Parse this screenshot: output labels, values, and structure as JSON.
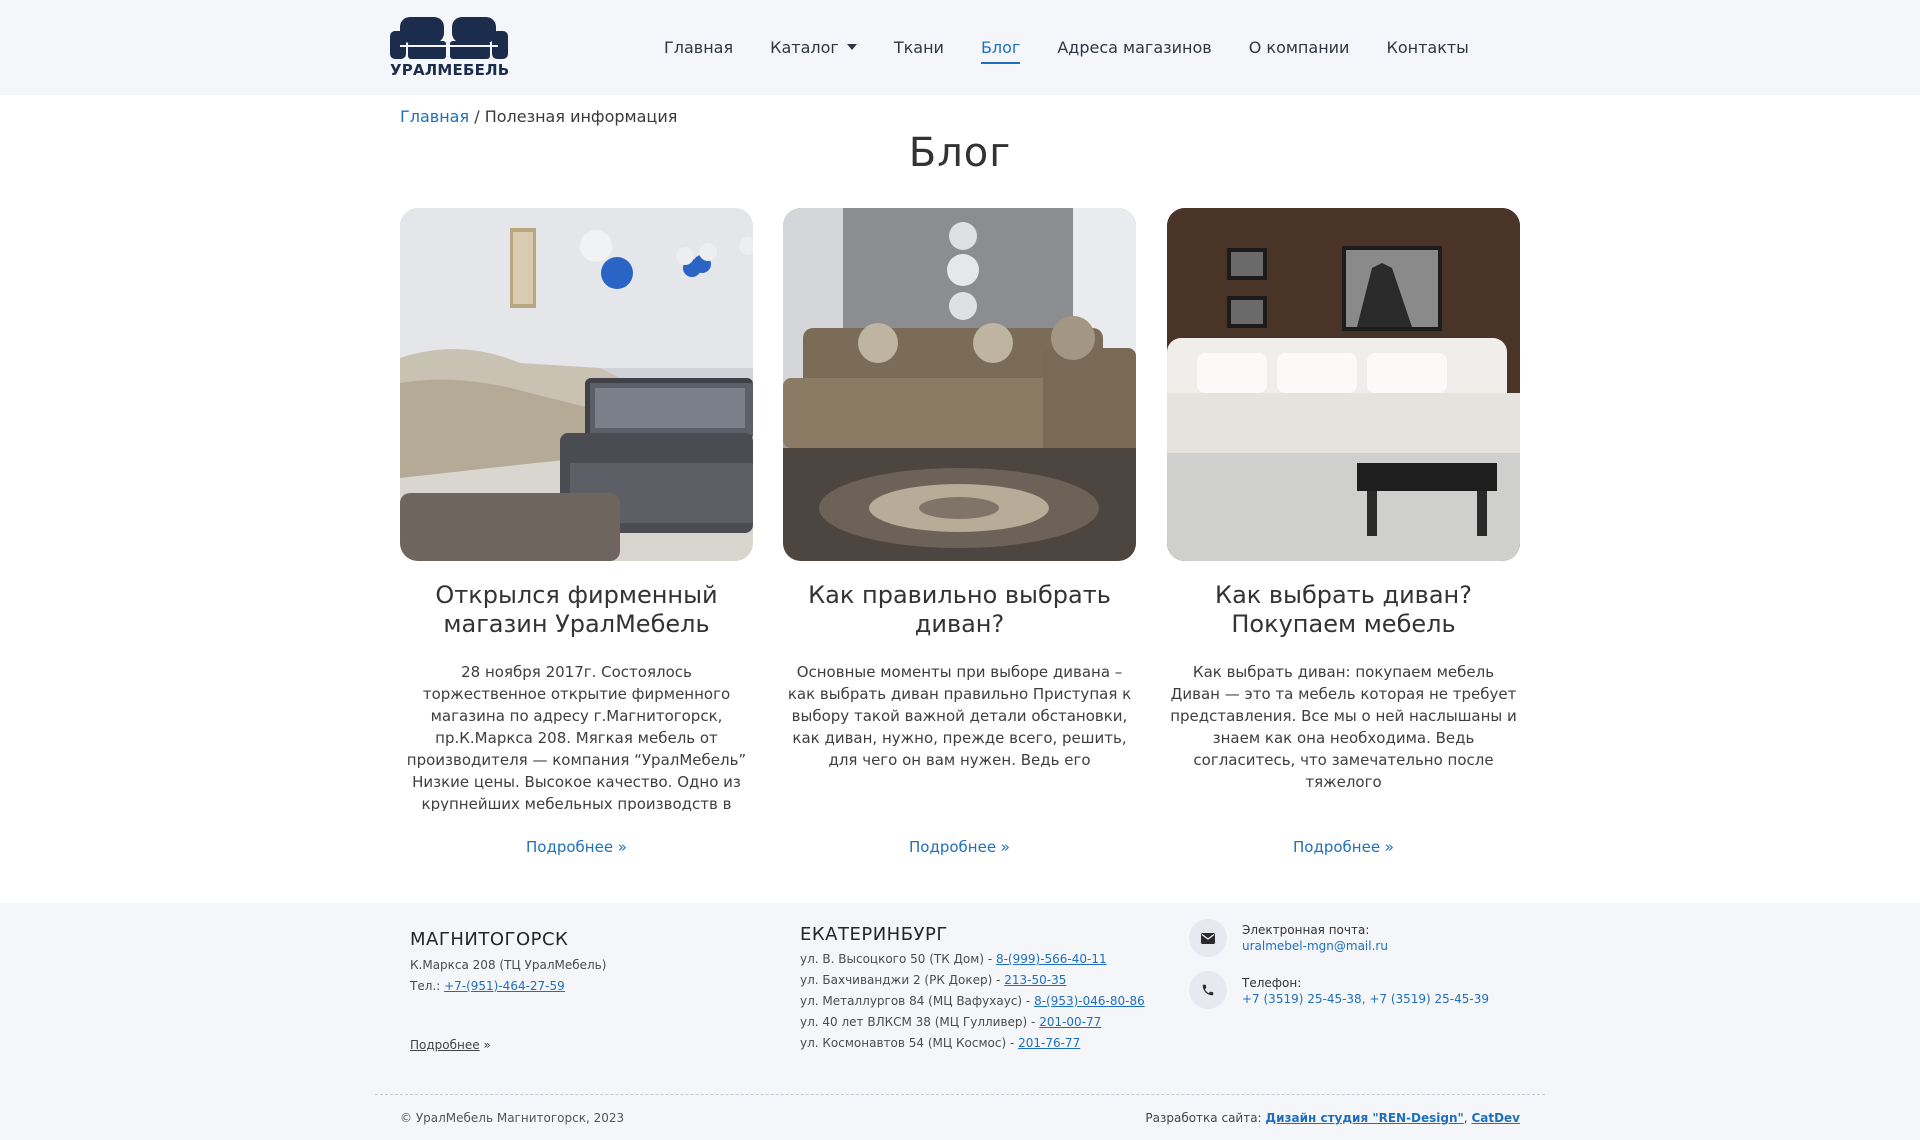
{
  "header": {
    "logo_text": "УРАЛМЕБЕЛЬ",
    "nav": [
      {
        "label": "Главная"
      },
      {
        "label": "Каталог"
      },
      {
        "label": "Ткани"
      },
      {
        "label": "Блог"
      },
      {
        "label": "Адреса магазинов"
      },
      {
        "label": "О компании"
      },
      {
        "label": "Контакты"
      }
    ],
    "active_nav": "Блог"
  },
  "breadcrumb": {
    "home": "Главная",
    "separator": "/",
    "current": "Полезная информация"
  },
  "page_title": "Блог",
  "cards": [
    {
      "title": "Открылся фирменный магазин УралМебель",
      "excerpt": "28 ноября 2017г. Состоялось торжественное открытие фирменного магазина по адресу г.Магнитогорск, пр.К.Маркса 208. Мягкая мебель от производителя — компания “УралМебель” Низкие цены. Высокое качество. Одно из крупнейших мебельных производств в",
      "more": "Подробнее »"
    },
    {
      "title": "Как правильно выбрать диван?",
      "excerpt": "Основные моменты при выборе дивана – как выбрать диван правильно Приступая к выбору такой важной детали обстановки, как диван, нужно, прежде всего, решить, для чего он вам нужен. Ведь его",
      "more": "Подробнее »"
    },
    {
      "title": "Как выбрать диван? Покупаем мебель",
      "excerpt": "Как выбрать диван: покупаем мебель Диван — это та мебель которая не требует представления. Все мы о ней наслышаны и знаем как она необходима. Ведь согласитесь, что замечательно после тяжелого",
      "more": "Подробнее »"
    }
  ],
  "footer": {
    "mgn": {
      "city": "МАГНИТОГОРСК",
      "address": "К.Маркса 208 (ТЦ УралМебель)",
      "phone_label": "Тел.: ",
      "phone": "+7-(951)-464-27-59",
      "more_link": "Подробнее",
      "more_suffix": " »"
    },
    "ekb": {
      "city": "ЕКАТЕРИНБУРГ",
      "stores": [
        {
          "address": "ул. В. Высоцкого 50 (ТК Дом) - ",
          "phone": "8-(999)-566-40-11"
        },
        {
          "address": "ул. Бахчиванджи 2 (РК Докер) - ",
          "phone": "213-50-35"
        },
        {
          "address": "ул. Металлургов 84 (МЦ Вафухаус) - ",
          "phone": "8-(953)-046-80-86"
        },
        {
          "address": "ул. 40 лет ВЛКСМ 38 (МЦ Гулливер) - ",
          "phone": "201-00-77"
        },
        {
          "address": "ул. Космонавтов 54 (МЦ Космос) - ",
          "phone": "201-76-77"
        }
      ]
    },
    "contacts": {
      "email_label": "Электронная почта:",
      "email": "uralmebel-mgn@mail.ru",
      "phone_label": "Телефон:",
      "phones": "+7 (3519) 25-45-38, +7 (3519) 25-45-39"
    },
    "copyright": "© УралМебель Магнитогорск, 2023",
    "dev_label": "Разработка сайта: ",
    "dev_studio": "Дизайн студия \"REN-Design\"",
    "dev_sep": ", ",
    "dev_other": "CatDev"
  },
  "colors": {
    "accent": "#1f6fbd",
    "header_bg": "#f4f6fa",
    "logo": "#1b2c4c"
  },
  "icons": [
    "logo-sofa-icon",
    "chevron-down-icon",
    "envelope-icon",
    "phone-icon"
  ]
}
